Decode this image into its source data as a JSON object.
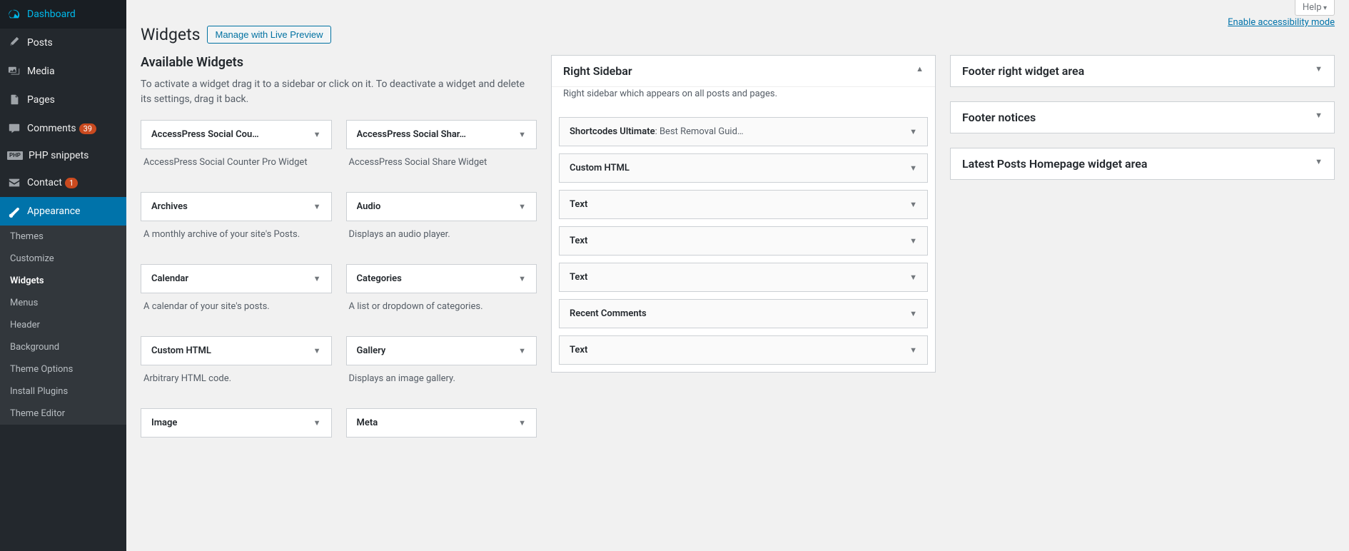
{
  "sidebar": {
    "dashboard": "Dashboard",
    "posts": "Posts",
    "media": "Media",
    "pages": "Pages",
    "comments": "Comments",
    "comments_badge": "39",
    "php_snippets": "PHP snippets",
    "contact": "Contact",
    "contact_badge": "1",
    "appearance": "Appearance",
    "submenu": {
      "themes": "Themes",
      "customize": "Customize",
      "widgets": "Widgets",
      "menus": "Menus",
      "header": "Header",
      "background": "Background",
      "theme_options": "Theme Options",
      "install_plugins": "Install Plugins",
      "theme_editor": "Theme Editor"
    }
  },
  "meta": {
    "help": "Help",
    "accessibility": "Enable accessibility mode"
  },
  "header": {
    "title": "Widgets",
    "preview_button": "Manage with Live Preview"
  },
  "available": {
    "heading": "Available Widgets",
    "help": "To activate a widget drag it to a sidebar or click on it. To deactivate a widget and delete its settings, drag it back.",
    "widgets": [
      {
        "title": "AccessPress Social Cou…",
        "desc": "AccessPress Social Counter Pro Widget"
      },
      {
        "title": "AccessPress Social Shar…",
        "desc": "AccessPress Social Share Widget"
      },
      {
        "title": "Archives",
        "desc": "A monthly archive of your site's Posts."
      },
      {
        "title": "Audio",
        "desc": "Displays an audio player."
      },
      {
        "title": "Calendar",
        "desc": "A calendar of your site's posts."
      },
      {
        "title": "Categories",
        "desc": "A list or dropdown of categories."
      },
      {
        "title": "Custom HTML",
        "desc": "Arbitrary HTML code."
      },
      {
        "title": "Gallery",
        "desc": "Displays an image gallery."
      },
      {
        "title": "Image",
        "desc": ""
      },
      {
        "title": "Meta",
        "desc": ""
      }
    ]
  },
  "areas_col1": {
    "right_sidebar": {
      "title": "Right Sidebar",
      "desc": "Right sidebar which appears on all posts and pages.",
      "widgets": [
        {
          "title": "Shortcodes Ultimate",
          "sub": ": Best Removal Guid…"
        },
        {
          "title": "Custom HTML",
          "sub": ""
        },
        {
          "title": "Text",
          "sub": ""
        },
        {
          "title": "Text",
          "sub": ""
        },
        {
          "title": "Text",
          "sub": ""
        },
        {
          "title": "Recent Comments",
          "sub": ""
        },
        {
          "title": "Text",
          "sub": ""
        }
      ]
    }
  },
  "areas_col2": [
    {
      "title": "Footer right widget area"
    },
    {
      "title": "Footer notices"
    },
    {
      "title": "Latest Posts Homepage widget area"
    }
  ]
}
